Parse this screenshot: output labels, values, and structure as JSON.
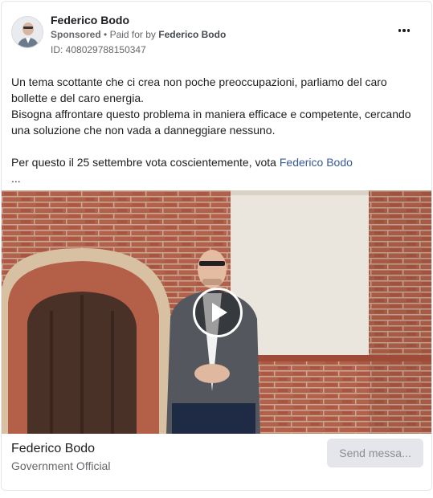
{
  "post": {
    "page_name": "Federico Bodo",
    "sponsored_label": "Sponsored",
    "separator": "•",
    "paid_for_prefix": "Paid for by",
    "paid_for_name": "Federico Bodo",
    "ad_id": "ID: 408029788150347"
  },
  "body": {
    "paragraph_1_line_1": "Un tema scottante che ci crea non poche preoccupazioni, parliamo del caro bollette e del caro energia.",
    "paragraph_1_line_2": "Bisogna affrontare questo problema in maniera efficace e competente, cercando una soluzione che non vada a danneggiare nessuno.",
    "paragraph_2_prefix": "Per questo il 25 settembre vota coscientemente, vota",
    "paragraph_2_mention": "Federico Bodo",
    "ellipsis": "..."
  },
  "footer": {
    "page_name": "Federico Bodo",
    "category": "Government Official",
    "send_button": "Send messa..."
  },
  "icons": {
    "more": "more-options-icon",
    "play": "play-icon",
    "avatar": "profile-avatar"
  },
  "colors": {
    "link": "#385898",
    "muted_text": "#65676b",
    "button_bg": "#e4e6eb",
    "button_text": "#8a8d91"
  }
}
